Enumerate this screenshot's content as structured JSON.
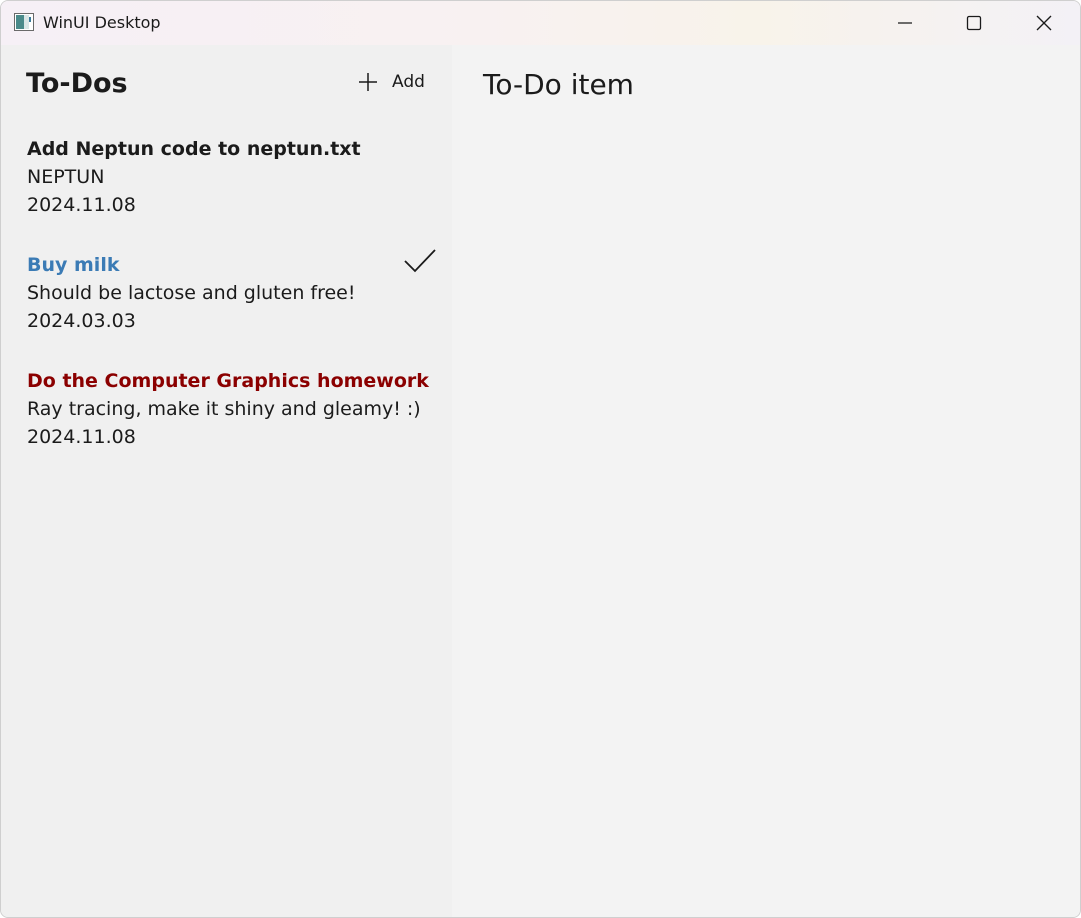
{
  "window": {
    "title": "WinUI Desktop",
    "icon": "app-window-icon"
  },
  "sidebar": {
    "title": "To-Dos",
    "add_label": "Add",
    "items": [
      {
        "title": "Add Neptun code to neptun.txt",
        "description": "NEPTUN",
        "date": "2024.11.08",
        "title_color": "#1b1b1b",
        "done": false
      },
      {
        "title": "Buy milk",
        "description": "Should be lactose and gluten free!",
        "date": "2024.03.03",
        "title_color": "#3b7bb5",
        "done": true
      },
      {
        "title": "Do the Computer Graphics homework",
        "description": "Ray tracing, make it shiny and gleamy! :)",
        "date": "2024.11.08",
        "title_color": "#8b0000",
        "done": false
      }
    ]
  },
  "main": {
    "title": "To-Do item"
  },
  "icons": {
    "minimize": "minimize-icon",
    "maximize": "maximize-icon",
    "close": "close-icon",
    "add": "plus-icon",
    "done": "checkmark-icon"
  }
}
